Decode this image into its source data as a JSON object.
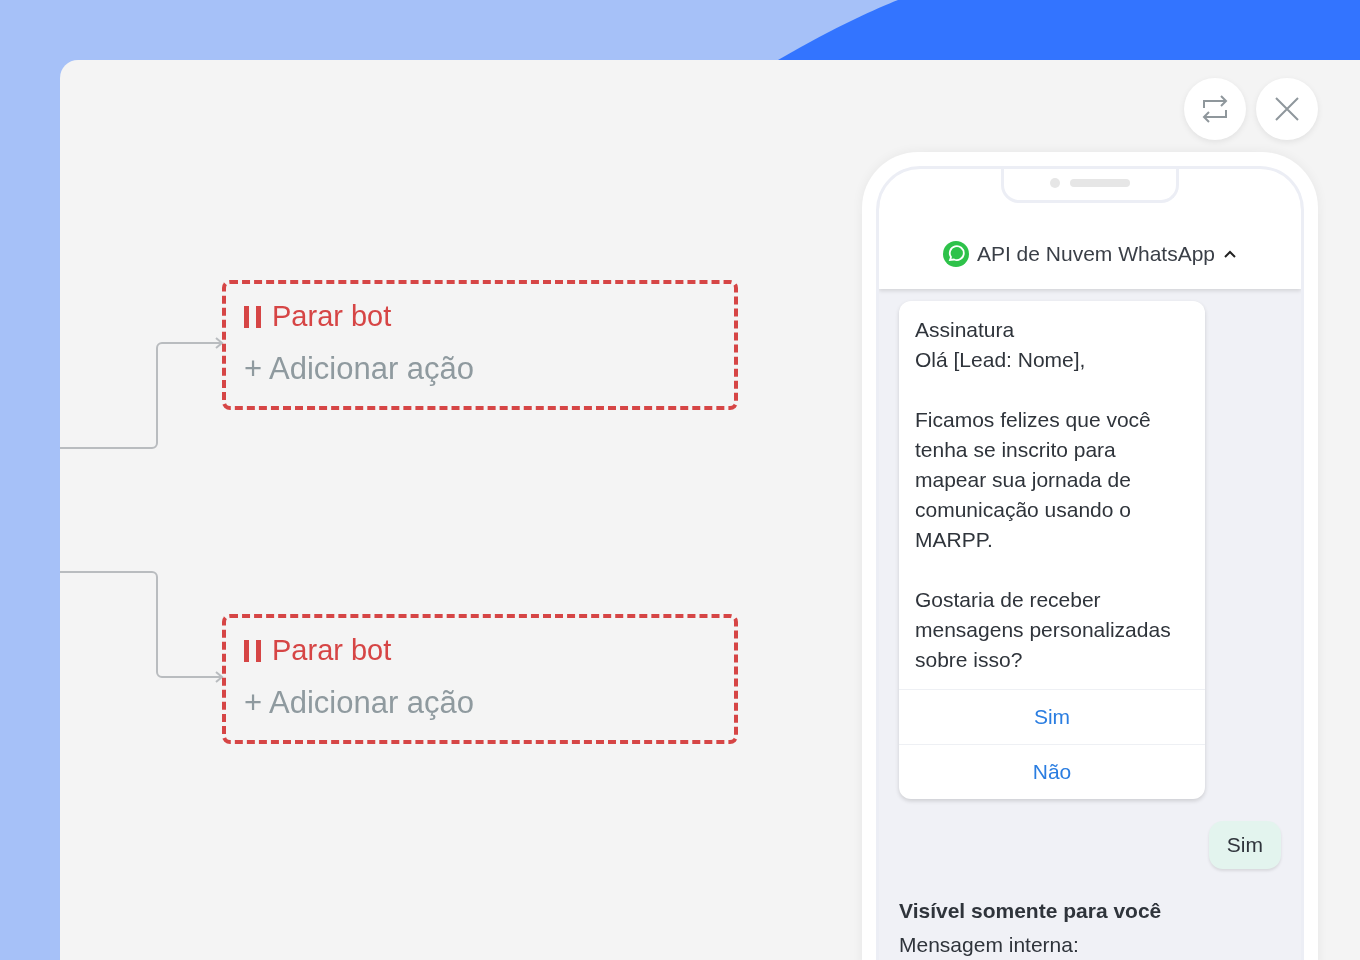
{
  "header_buttons": [
    {
      "kind": "swap"
    },
    {
      "kind": "close"
    }
  ],
  "flow_nodes": [
    {
      "stop_label": "Parar bot",
      "add_label": "+ Adicionar ação",
      "kind": "from_below"
    },
    {
      "stop_label": "Parar bot",
      "add_label": "+ Adicionar ação",
      "kind": "from_above"
    }
  ],
  "preview": {
    "channel": "API de Nuvem WhatsApp",
    "expanded": true,
    "message": {
      "paragraphs": [
        "Assinatura\nOlá [Lead: Nome],",
        "Ficamos felizes que você tenha se inscrito para mapear sua jornada de comunicação usando o MARPP.",
        "Gostaria de receber mensagens personalizadas sobre isso?"
      ],
      "options": [
        "Sim",
        "Não"
      ]
    },
    "reply": "Sim",
    "internal_note": {
      "title": "Visível somente para você",
      "text": "Mensagem interna:"
    }
  }
}
